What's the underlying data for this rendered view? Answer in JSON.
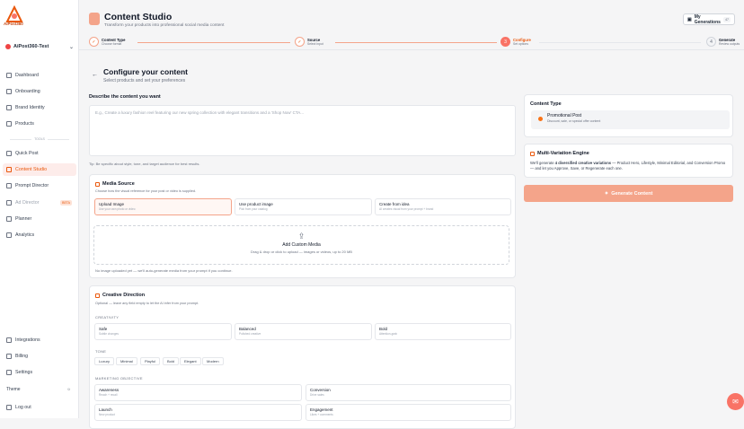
{
  "brand": {
    "logo_text": "AiPost360",
    "accent": "#f97366"
  },
  "workspace": {
    "name": "AiPost360-Test"
  },
  "nav": {
    "dashboard": "Dashboard",
    "onboarding": "Onboarding",
    "brand_identity": "Brand Identity",
    "products": "Products",
    "divider": "TOOLS",
    "quick_post": "Quick Post",
    "content_studio": "Content Studio",
    "prompt_director": "Prompt Director",
    "ad_director": "Ad Director",
    "ad_director_badge": "BETA",
    "planner": "Planner",
    "analytics": "Analytics",
    "integrations": "Integrations",
    "billing": "Billing",
    "settings": "Settings",
    "theme": "Theme",
    "logout": "Log out"
  },
  "header": {
    "title": "Content Studio",
    "subtitle": "Transform your products into professional social media content",
    "my_generations": "My Generations",
    "my_generations_count": "47"
  },
  "steps": [
    {
      "n": "✓",
      "title": "Content Type",
      "sub": "Choose format"
    },
    {
      "n": "✓",
      "title": "Source",
      "sub": "Select input"
    },
    {
      "n": "3",
      "title": "Configure",
      "sub": "Set options"
    },
    {
      "n": "4",
      "title": "Generate",
      "sub": "Review outputs"
    }
  ],
  "configure": {
    "title": "Configure your content",
    "subtitle": "Select products and set your preferences",
    "describe_label": "Describe the content you want",
    "describe_placeholder": "E.g., Create a luxury fashion reel featuring our new spring collection with elegant transitions and a 'Shop Now' CTA...",
    "tip": "Tip: Be specific about style, tone, and target audience for best results."
  },
  "media_source": {
    "title": "Media Source",
    "subtitle": "Choose how the visual reference for your post or video is supplied.",
    "options": [
      {
        "title": "Upload Image",
        "sub": "Use your own photo or video"
      },
      {
        "title": "Use product image",
        "sub": "Pick from your catalog"
      },
      {
        "title": "Create from idea",
        "sub": "AI creates visual from your prompt + brand"
      }
    ],
    "drop_title": "Add Custom Media",
    "drop_sub": "Drag & drop or click to upload — images or videos, up to 20 MB",
    "note": "No image uploaded yet — we'll auto-generate media from your prompt if you continue."
  },
  "creative": {
    "title": "Creative Direction",
    "subtitle": "Optional — leave any field empty to let the AI infer from your prompt.",
    "creativity_label": "CREATIVITY",
    "creativity": [
      {
        "title": "Safe",
        "sub": "Subtle changes"
      },
      {
        "title": "Balanced",
        "sub": "Polished creative"
      },
      {
        "title": "Bold",
        "sub": "Attention-grab"
      }
    ],
    "tone_label": "TONE",
    "tones": [
      "Luxury",
      "Minimal",
      "Playful",
      "Bold",
      "Elegant",
      "Modern"
    ],
    "objective_label": "MARKETING OBJECTIVE",
    "objectives": [
      {
        "title": "Awareness",
        "sub": "Reach + recall"
      },
      {
        "title": "Conversion",
        "sub": "Drive sales"
      },
      {
        "title": "Launch",
        "sub": "New product"
      },
      {
        "title": "Engagement",
        "sub": "Likes + comments"
      }
    ]
  },
  "right": {
    "content_type_title": "Content Type",
    "promo_title": "Promotional Post",
    "promo_sub": "Discount, sale, or special offer content",
    "mv_title": "Multi-Variation Engine",
    "mv_text_pre": "We'll generate ",
    "mv_bold": "4 diversified creative variations",
    "mv_text_post": " — Product Hero, Lifestyle, Minimal Editorial, and Conversion Promo — and let you Approve, Save, or Regenerate each one.",
    "generate": "Generate Content"
  }
}
